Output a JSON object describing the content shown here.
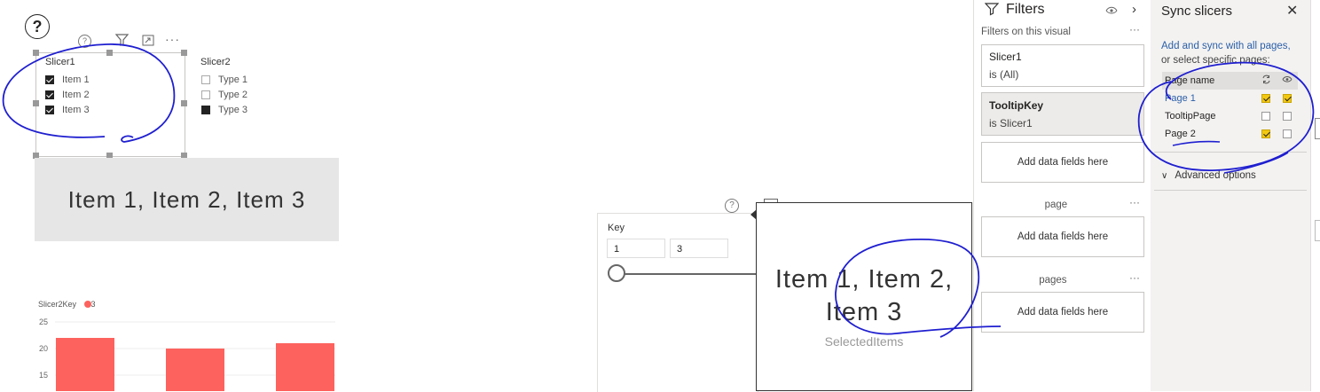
{
  "help_symbol": "?",
  "slicer1": {
    "title": "Slicer1",
    "items": [
      {
        "label": "Item 1",
        "checked": true
      },
      {
        "label": "Item 2",
        "checked": true
      },
      {
        "label": "Item 3",
        "checked": true
      }
    ]
  },
  "slicer2": {
    "title": "Slicer2",
    "items": [
      {
        "label": "Type 1",
        "checked": false
      },
      {
        "label": "Type 2",
        "checked": false
      },
      {
        "label": "Type 3",
        "checked": true
      }
    ]
  },
  "card": {
    "text": "Item 1, Item 2, Item 3"
  },
  "chart_data": {
    "type": "bar",
    "legend_title": "Slicer2Key",
    "legend_entry": "3",
    "series_color": "#fd625e",
    "yticks": [
      "25",
      "20",
      "15"
    ],
    "ylim": [
      15,
      25
    ],
    "values": [
      22,
      20,
      21
    ]
  },
  "range_slicer": {
    "title": "Key",
    "min_value": "1",
    "max_value": "3"
  },
  "tooltip": {
    "line1": "Item 1, Item 2,",
    "line2": "Item 3",
    "caption": "SelectedItems"
  },
  "filters": {
    "title": "Filters",
    "section_visual": "Filters on this visual",
    "more": "···",
    "cards": [
      {
        "title": "Slicer1",
        "sub": "is (All)"
      },
      {
        "title": "TooltipKey",
        "sub": "is Slicer1"
      }
    ],
    "add_fields": "Add data fields here",
    "section_page": "page",
    "section_all": "pages"
  },
  "sync": {
    "title": "Sync slicers",
    "desc1": "Add and sync with all pages,",
    "desc2": "or select specific pages:",
    "header_col": "Page name",
    "pages": [
      {
        "name": "Page 1",
        "sync": true,
        "visible": true,
        "link": true
      },
      {
        "name": "TooltipPage",
        "sync": false,
        "visible": false,
        "link": false
      },
      {
        "name": "Page 2",
        "sync": true,
        "visible": false,
        "link": false
      }
    ],
    "advanced": "Advanced options"
  },
  "colors": {
    "annotation": "#1f1fd0",
    "accent": "#f2c811",
    "link": "#2b5fa8"
  }
}
